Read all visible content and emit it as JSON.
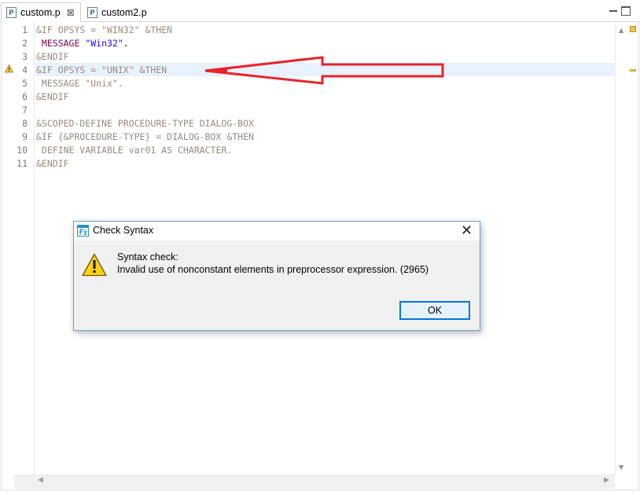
{
  "tabs": [
    {
      "label": "custom.p",
      "icon": "progress-file-icon",
      "icon_glyph": "P",
      "active": true,
      "close": "⊠"
    },
    {
      "label": "custom2.p",
      "icon": "progress-file-icon",
      "icon_glyph": "P",
      "active": false
    }
  ],
  "editor": {
    "lines": [
      {
        "n": "1",
        "text": "&IF OPSYS = \"WIN32\" &THEN"
      },
      {
        "n": "2",
        "kw": " MESSAGE ",
        "str": "\"Win32\"",
        "tail": "."
      },
      {
        "n": "3",
        "text": "&ENDIF"
      },
      {
        "n": "4",
        "text": "&IF OPSYS = \"UNIX\" &THEN"
      },
      {
        "n": "5",
        "text": " MESSAGE \"Unix\"."
      },
      {
        "n": "6",
        "text": "&ENDIF"
      },
      {
        "n": "7",
        "text": ""
      },
      {
        "n": "8",
        "text": "&SCOPED-DEFINE PROCEDURE-TYPE DIALOG-BOX"
      },
      {
        "n": "9",
        "text": "&IF {&PROCEDURE-TYPE} = DIALOG-BOX &THEN"
      },
      {
        "n": "10",
        "text": " DEFINE VARIABLE var01 AS CHARACTER."
      },
      {
        "n": "11",
        "text": "&ENDIF"
      }
    ],
    "warning_line": "4"
  },
  "dialog": {
    "title": "Check Syntax",
    "close": "✕",
    "message_line1": "Syntax check:",
    "message_line2": "Invalid use of nonconstant elements in preprocessor expression. (2965)",
    "ok_label": "OK"
  },
  "colors": {
    "accent": "#0078d7",
    "annotation": "#e8232a",
    "keyword": "#7f0055",
    "string": "#2a00ff"
  }
}
